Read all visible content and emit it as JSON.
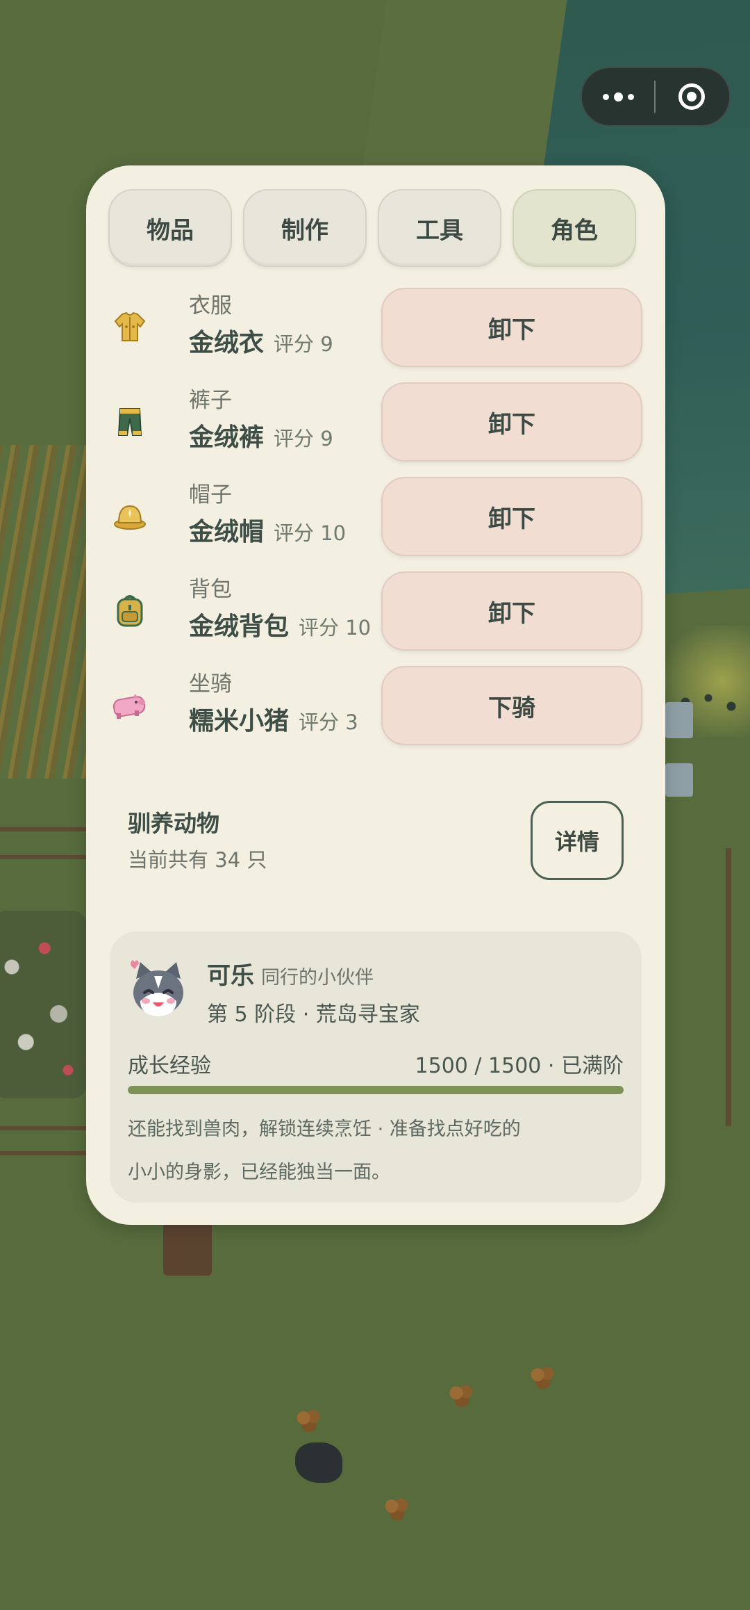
{
  "tabs": [
    {
      "label": "物品",
      "active": false
    },
    {
      "label": "制作",
      "active": false
    },
    {
      "label": "工具",
      "active": false
    },
    {
      "label": "角色",
      "active": true
    }
  ],
  "equipment": [
    {
      "slot": "衣服",
      "name": "金绒衣",
      "score": "评分 9",
      "action": "卸下",
      "icon": "shirt-icon"
    },
    {
      "slot": "裤子",
      "name": "金绒裤",
      "score": "评分 9",
      "action": "卸下",
      "icon": "pants-icon"
    },
    {
      "slot": "帽子",
      "name": "金绒帽",
      "score": "评分 10",
      "action": "卸下",
      "icon": "hat-icon"
    },
    {
      "slot": "背包",
      "name": "金绒背包",
      "score": "评分 10",
      "action": "卸下",
      "icon": "backpack-icon"
    },
    {
      "slot": "坐骑",
      "name": "糯米小猪",
      "score": "评分 3",
      "action": "下骑",
      "icon": "pig-icon"
    }
  ],
  "tame": {
    "title": "驯养动物",
    "count": "当前共有 34 只",
    "detail_label": "详情"
  },
  "pet": {
    "name": "可乐",
    "subtitle": "同行的小伙伴",
    "stage": "第 5 阶段 · 荒岛寻宝家",
    "exp_label": "成长经验",
    "exp_value": "1500 / 1500 · 已满阶",
    "exp_progress": 1.0,
    "line1": "还能找到兽肉，解锁连续烹饪 · 准备找点好吃的",
    "line2": "小小的身影，已经能独当一面。"
  },
  "colors": {
    "panel": "#f3f0e2",
    "tab_active": "#e2e4cd",
    "action_button": "#f2ddd2",
    "progress_fill": "#7d9258",
    "text_dark": "#3e4e46"
  }
}
